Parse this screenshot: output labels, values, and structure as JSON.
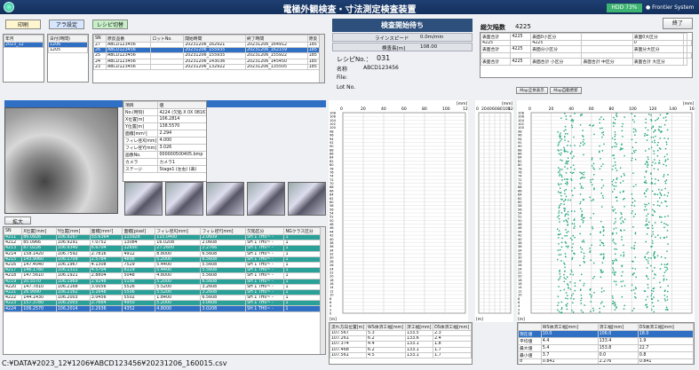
{
  "window": {
    "title": "電極外観検査・寸法測定検査装置",
    "hdd": "HDD 73%",
    "brand": "Frontier System"
  },
  "toolbar": {
    "print": "印刷",
    "alarm": "アラ設定",
    "recipe": "レシピ切替",
    "end": "終了"
  },
  "year_list": {
    "header": "年月",
    "items": [
      "2023_12"
    ]
  },
  "day_list": {
    "header": "日付(時間)",
    "items": [
      "1206",
      "1205"
    ]
  },
  "lot_table": {
    "headers": [
      "SN",
      "原反品番",
      "ロットNo.",
      "開始時間",
      "終了時間",
      "原反"
    ],
    "rows": [
      [
        "27",
        "ABCD123456",
        "",
        "20231206_162921",
        "20231206_164912",
        "185"
      ],
      [
        "26",
        "ABCD123456",
        "",
        "20231206_155935",
        "20231206_162159",
        "185"
      ],
      [
        "25",
        "ABCD123456",
        "",
        "20231206_155935",
        "20231206_155922",
        "185"
      ],
      [
        "24",
        "ABCD123456",
        "",
        "20231206_143036",
        "20231206_145450",
        "185"
      ],
      [
        "23",
        "ABCD123456",
        "",
        "20231206_132922",
        "20231206_135505",
        "185"
      ]
    ],
    "selected": 1
  },
  "status_box": {
    "state": "検査開始待ち",
    "line_speed_label": "ラインスピード",
    "line_speed": "0.0m/min",
    "length_label": "検査長[m]",
    "length": "108.00"
  },
  "recipe": {
    "recipe_label": "レシピNo.：",
    "recipe": "031",
    "name_label": "名称",
    "name": "ABCD123456",
    "file_label": "File:",
    "lot_label": "Lot No."
  },
  "defect_total": {
    "label": "総欠陥数",
    "value": "4225"
  },
  "defect_table": {
    "rows": [
      [
        "表面合計",
        "4225",
        "表面0小区分",
        "",
        "表面0大区分",
        ""
      ],
      [
        "4225",
        "",
        "4225",
        "",
        "0",
        "",
        ""
      ],
      [
        "表面合計",
        "4225",
        "表面分小区分",
        "",
        "表面分大区分",
        ""
      ],
      [
        "",
        "",
        "",
        "",
        "",
        "",
        ""
      ],
      [
        "表面合計",
        "4225",
        "表面合計 小区分",
        "表面合計 中区分",
        "表面合計 大区分",
        ""
      ]
    ]
  },
  "map_buttons": {
    "all": "Map全体表示",
    "auto": "Map自動更新"
  },
  "detail": {
    "headers": [
      "項目",
      "値"
    ],
    "rows": [
      [
        "No.(時刻)",
        "4224 (欠陥 X 0X 0816)"
      ],
      [
        "X位置[m]",
        "106.2814"
      ],
      [
        "Y位置[m]",
        "138.5570"
      ],
      [
        "面積[mm²]",
        "2.294"
      ],
      [
        "フィレ径X[mm]",
        "4.000"
      ],
      [
        "フィレ径Y[mm]",
        "3.026"
      ],
      [
        "画像No.",
        "000000500405.bmp"
      ],
      [
        "カメラ",
        "カメラ1"
      ],
      [
        "ステージ",
        "Stage1 (左右) (表)"
      ]
    ]
  },
  "zoom_label": "拡大",
  "defects": {
    "headers": [
      "SN",
      "X位置[mm]",
      "Y位置[mm]",
      "面積[mm²]",
      "面積[pixel]",
      "フィレ径X[mm]",
      "フィレ径Y[mm]",
      "欠陥区分",
      "NGクラス区分"
    ],
    "rows": [
      [
        "4211",
        "86.0926",
        "106.9267",
        "55.6364",
        "115928",
        "115.0400",
        "2.0609",
        "SH 1 TH0~ -",
        "1"
      ],
      [
        "4212",
        "85.0966",
        "106.9291",
        "7.0752",
        "13084",
        "16.0208",
        "2.0608",
        "SH 1 TH0~ -",
        "1"
      ],
      [
        "4213",
        "87.0226",
        "106.9340",
        "6.6704",
        "12690",
        "27.2600",
        "2.2766",
        "SH 1 TH0~ -",
        "1"
      ],
      [
        "4214",
        "158.1420",
        "106.7592",
        "2.7816",
        "4912",
        "8.8000",
        "6.5608",
        "SH 1 TH0~ -",
        "1"
      ],
      [
        "4215",
        "143.9060",
        "106.1709",
        "2.5784",
        "4898",
        "5.2000",
        "6.5608",
        "SH 1 TH0~ -",
        "1"
      ],
      [
        "4216",
        "147.4040",
        "106.1967",
        "4.1308",
        "7529",
        "5.4400",
        "5.5608",
        "SH 1 TH0~ -",
        "1"
      ],
      [
        "4217",
        "146.1780",
        "106.1311",
        "4.5704",
        "8129",
        "5.4400",
        "5.5608",
        "SH 1 TH0~ -",
        "1"
      ],
      [
        "4218",
        "147.5610",
        "106.1921",
        "2.8804",
        "5048",
        "4.8000",
        "5.5608",
        "SH 1 TH0~ -",
        "1"
      ],
      [
        "4219",
        "20.5570",
        "106.1969",
        "2.9248",
        "5198",
        "5.2000",
        "6.5608",
        "SH 1 TH0~ -",
        "1"
      ],
      [
        "4220",
        "147.7810",
        "106.2168",
        "3.0056",
        "5526",
        "5.5200",
        "3.2608",
        "SH 1 TH0~ -",
        "1"
      ],
      [
        "4221",
        "26.9990",
        "106.2162",
        "3.1648",
        "5506",
        "5.5200",
        "3.2608",
        "SH 1 TH0~ -",
        "1"
      ],
      [
        "4222",
        "144.1430",
        "106.2003",
        "3.0456",
        "5502",
        "1.8400",
        "6.5608",
        "SH 1 TH0~ -",
        "1"
      ],
      [
        "4223",
        "157.3780",
        "106.2003",
        "2.7664",
        "4950",
        "5.2000",
        "3.0608",
        "SH 1 TH0~ -",
        "1"
      ],
      [
        "4224",
        "106.2570",
        "106.2014",
        "2.2936",
        "4352",
        "4.8000",
        "3.0208",
        "SH 1 TH0~ -",
        "1"
      ]
    ],
    "row_styles": [
      "teal",
      "",
      "teal",
      "",
      "teal",
      "",
      "teal",
      "",
      "teal",
      "",
      "teal",
      "",
      "teal",
      "blue"
    ]
  },
  "measure_table": {
    "headers": [
      "流れ方向位置[m]",
      "WS体済工幅[mm]",
      "済工幅[mm]",
      "DS体済工幅[mm]"
    ],
    "rows": [
      [
        "107.567",
        "5.3",
        "133.5",
        "2.3"
      ],
      [
        "107.261",
        "6.2",
        "133.6",
        "2.4"
      ],
      [
        "107.374",
        "4.4",
        "133.1",
        "1.8"
      ],
      [
        "107.468",
        "6.2",
        "133.1",
        "1.7"
      ],
      [
        "107.561",
        "4.5",
        "133.1",
        "1.7"
      ]
    ]
  },
  "stats_table": {
    "headers": [
      "",
      "WS体済工幅[mm]",
      "済工幅[mm]",
      "DS体済工幅[mm]"
    ],
    "rows": [
      [
        "現在値",
        "10.0",
        "106.0",
        "18.0"
      ],
      [
        "平均値",
        "4.4",
        "133.4",
        "1.9"
      ],
      [
        "最大値",
        "5.4",
        "153.8",
        "22.7"
      ],
      [
        "最小値",
        "3.7",
        "0.0",
        "0.8"
      ],
      [
        "σ",
        "0.841",
        "2.276",
        "0.841"
      ]
    ]
  },
  "chart_axes": {
    "x_ticks_a": [
      "0",
      "20",
      "40",
      "60",
      "80",
      "100",
      "120"
    ],
    "x_ticks_b": [
      "0",
      "20",
      "40",
      "60",
      "80",
      "100",
      "120",
      "140",
      "160"
    ],
    "unit": "[mm]",
    "y_unit": "[m]",
    "y_ticks": [
      "108",
      "106",
      "104",
      "102",
      "100",
      "98",
      "96",
      "94",
      "92",
      "90",
      "88",
      "86",
      "84",
      "82",
      "80",
      "78",
      "76",
      "74",
      "72",
      "70",
      "68",
      "66",
      "64",
      "62",
      "60",
      "58",
      "56",
      "54",
      "52",
      "50",
      "48",
      "46",
      "44",
      "42",
      "40",
      "38",
      "36",
      "34",
      "32",
      "30",
      "28",
      "26",
      "24",
      "22",
      "20",
      "18",
      "16",
      "14",
      "12",
      "10",
      "8",
      "6",
      "4",
      "2",
      "0"
    ]
  },
  "file_path": "C:¥DATA¥2023_12¥1206¥ABCD123456¥20231206_160015.csv",
  "colors": {
    "title_bg": "#1f3f73",
    "teal": "#2aa198",
    "select": "#2f6fc4",
    "defect": "#1aa37a"
  }
}
